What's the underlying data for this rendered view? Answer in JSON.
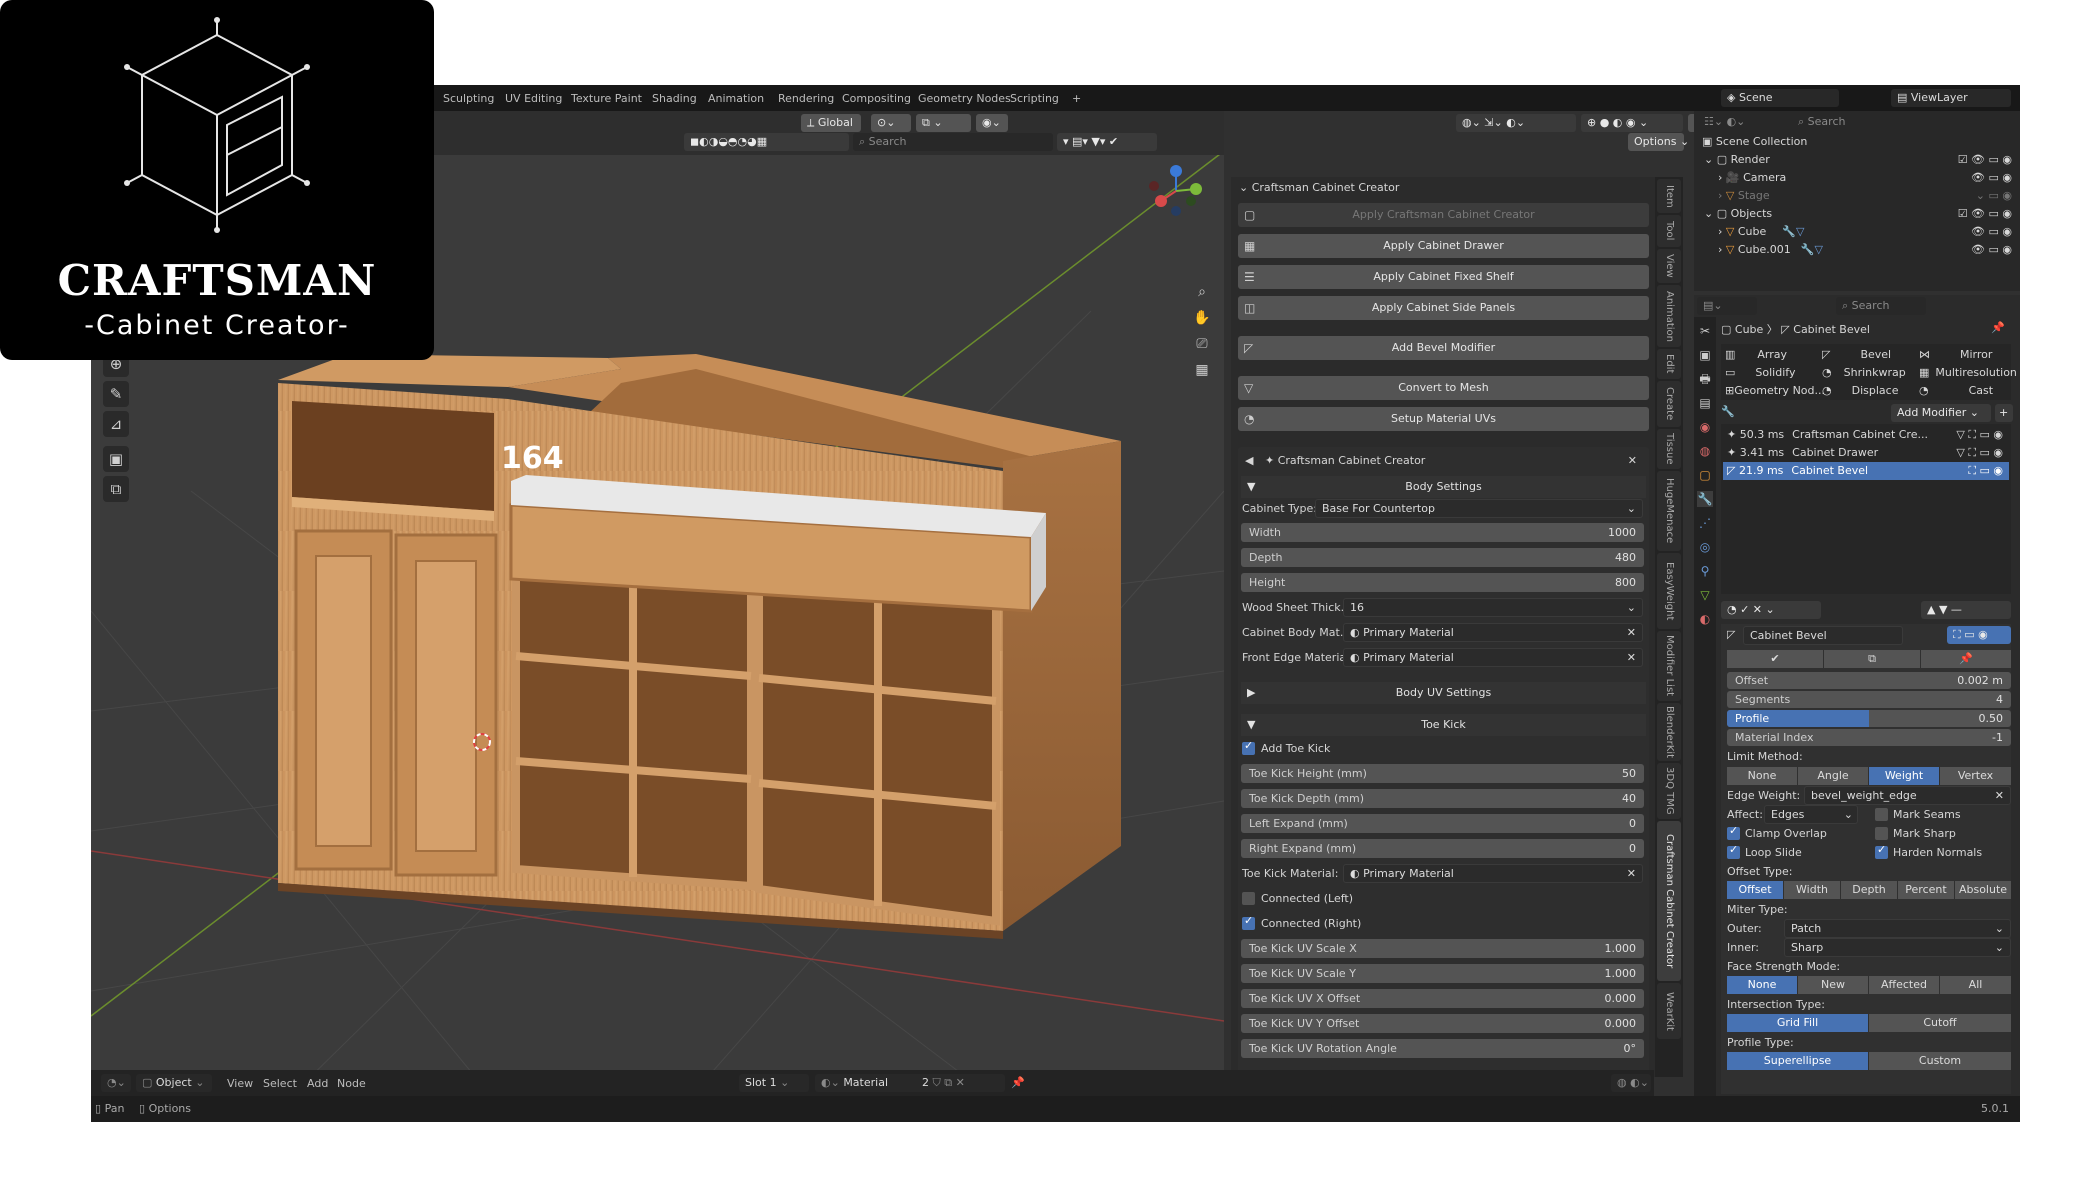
{
  "logo": {
    "title": "CRAFTSMAN",
    "subtitle": "-Cabinet Creator-"
  },
  "workspaces": [
    "Sculpting",
    "UV Editing",
    "Texture Paint",
    "Shading",
    "Animation",
    "Rendering",
    "Compositing",
    "Geometry Nodes",
    "Scripting",
    "+"
  ],
  "window_controls": {
    "minimize": "—",
    "maximize": "❐",
    "close": "✕"
  },
  "topbar_right": {
    "scene": "Scene",
    "view_layer": "ViewLayer"
  },
  "viewport_header": {
    "orientation": "Global",
    "search_placeholder": "Search",
    "options": "Options"
  },
  "viewport": {
    "dimension_label": "164"
  },
  "npanel": {
    "header": "Craftsman Cabinet Creator",
    "buttons": [
      "Apply Craftsman Cabinet Creator",
      "Apply Cabinet Drawer",
      "Apply Cabinet Fixed Shelf",
      "Apply Cabinet Side Panels",
      "Add Bevel Modifier",
      "Convert to Mesh",
      "Setup Material UVs"
    ],
    "sub_header": "Craftsman Cabinet Creator",
    "body_settings": "Body Settings",
    "cabinet_type_label": "Cabinet Type:",
    "cabinet_type_value": "Base For Countertop",
    "width_label": "Width",
    "width_value": "1000",
    "depth_label": "Depth",
    "depth_value": "480",
    "height_label": "Height",
    "height_value": "800",
    "wood_sheet_label": "Wood Sheet Thick...",
    "wood_sheet_value": "16",
    "body_material_label": "Cabinet Body Mat...",
    "body_material_value": "Primary Material",
    "front_edge_label": "Front Edge Material:",
    "front_edge_value": "Primary Material",
    "body_uv_settings": "Body UV Settings",
    "toe_kick": "Toe Kick",
    "add_toe_kick": "Add Toe Kick",
    "toe_kick_height_label": "Toe Kick Height (mm)",
    "toe_kick_height_value": "50",
    "toe_kick_depth_label": "Toe Kick Depth (mm)",
    "toe_kick_depth_value": "40",
    "left_expand_label": "Left Expand (mm)",
    "left_expand_value": "0",
    "right_expand_label": "Right Expand (mm)",
    "right_expand_value": "0",
    "toe_kick_material_label": "Toe Kick Material:",
    "toe_kick_material_value": "Primary Material",
    "connected_left": "Connected (Left)",
    "connected_right": "Connected (Right)",
    "uv_scale_x_label": "Toe Kick UV Scale X",
    "uv_scale_x_value": "1.000",
    "uv_scale_y_label": "Toe Kick UV Scale Y",
    "uv_scale_y_value": "1.000",
    "uv_x_offset_label": "Toe Kick UV X Offset",
    "uv_x_offset_value": "0.000",
    "uv_y_offset_label": "Toe Kick UV Y Offset",
    "uv_y_offset_value": "0.000",
    "uv_rotation_label": "Toe Kick UV Rotation Angle",
    "uv_rotation_value": "0°"
  },
  "vertical_tabs": [
    "Item",
    "Tool",
    "View",
    "Animation",
    "Edit",
    "Create",
    "Tissue",
    "HugeMenace",
    "EasyWeight",
    "Modifier List",
    "BlenderKit",
    "3DQ TMG",
    "Craftsman Cabinet Creator",
    "WearKit"
  ],
  "outliner": {
    "search_placeholder": "Search",
    "scene_collection": "Scene Collection",
    "render": "Render",
    "camera": "Camera",
    "stage": "Stage",
    "objects": "Objects",
    "cube": "Cube",
    "cube001": "Cube.001"
  },
  "properties": {
    "search_placeholder": "Search",
    "breadcrumb_object": "Cube",
    "breadcrumb_modifier": "Cabinet Bevel",
    "modifier_grid": [
      "Array",
      "Bevel",
      "Mirror",
      "Solidify",
      "Shrinkwrap",
      "Multiresolution",
      "Geometry Nod...",
      "Displace",
      "Cast"
    ],
    "add_modifier": "Add Modifier",
    "stack": [
      {
        "time": "50.3 ms",
        "name": "Craftsman Cabinet Cre..."
      },
      {
        "time": "3.41 ms",
        "name": "Cabinet Drawer"
      },
      {
        "time": "21.9 ms",
        "name": "Cabinet Bevel"
      }
    ],
    "modifier_name": "Cabinet Bevel",
    "offset_label": "Offset",
    "offset_value": "0.002 m",
    "segments_label": "Segments",
    "segments_value": "4",
    "profile_label": "Profile",
    "profile_value": "0.50",
    "profile_fraction": 0.5,
    "material_index_label": "Material Index",
    "material_index_value": "-1",
    "limit_method": "Limit Method:",
    "limit_options": [
      "None",
      "Angle",
      "Weight",
      "Vertex Group"
    ],
    "edge_weight_label": "Edge Weight:",
    "edge_weight_value": "bevel_weight_edge",
    "affect_label": "Affect:",
    "affect_value": "Edges",
    "mark_seams": "Mark Seams",
    "clamp_overlap": "Clamp Overlap",
    "mark_sharp": "Mark Sharp",
    "loop_slide": "Loop Slide",
    "harden_normals": "Harden Normals",
    "offset_type": "Offset Type:",
    "offset_type_options": [
      "Offset",
      "Width",
      "Depth",
      "Percent",
      "Absolute"
    ],
    "miter_type": "Miter Type:",
    "outer_label": "Outer:",
    "outer_value": "Patch",
    "inner_label": "Inner:",
    "inner_value": "Sharp",
    "face_strength": "Face Strength Mode:",
    "face_strength_options": [
      "None",
      "New",
      "Affected",
      "All"
    ],
    "intersection_type": "Intersection Type:",
    "intersection_options": [
      "Grid Fill",
      "Cutoff"
    ],
    "profile_type": "Profile Type:",
    "profile_type_options": [
      "Superellipse",
      "Custom"
    ]
  },
  "bottom_header": {
    "mode": "Object",
    "view": "View",
    "select": "Select",
    "add": "Add",
    "node": "Node",
    "slot": "Slot 1",
    "material": "Material",
    "users": "2"
  },
  "statusbar": {
    "pan": "Pan",
    "options": "Options",
    "version": "5.0.1"
  }
}
